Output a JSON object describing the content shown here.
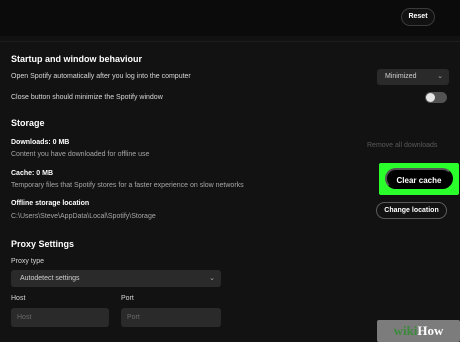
{
  "topbar": {
    "reset_label": "Reset"
  },
  "startup": {
    "title": "Startup and window behaviour",
    "open_label": "Open Spotify automatically after you log into the computer",
    "open_value": "Minimized",
    "close_label": "Close button should minimize the Spotify window",
    "close_toggle_on": false
  },
  "storage": {
    "title": "Storage",
    "downloads_label": "Downloads: 0 MB",
    "downloads_desc": "Content you have downloaded for offline use",
    "remove_downloads_label": "Remove all downloads",
    "cache_label": "Cache: 0 MB",
    "cache_desc": "Temporary files that Spotify stores for a faster experience on slow networks",
    "clear_cache_label": "Clear cache",
    "offline_location_label": "Offline storage location",
    "offline_location_path": "C:\\Users\\Steve\\AppData\\Local\\Spotify\\Storage",
    "change_location_label": "Change location"
  },
  "proxy": {
    "title": "Proxy Settings",
    "type_label": "Proxy type",
    "type_value": "Autodetect settings",
    "host_label": "Host",
    "host_placeholder": "Host",
    "port_label": "Port",
    "port_placeholder": "Port"
  },
  "watermark": {
    "part1": "wiki",
    "part2": "How"
  },
  "colors": {
    "highlight": "#2bff2b",
    "background": "#121212",
    "field": "#2a2a2a"
  },
  "icons": {
    "dropdown": "chevron-down-icon"
  }
}
